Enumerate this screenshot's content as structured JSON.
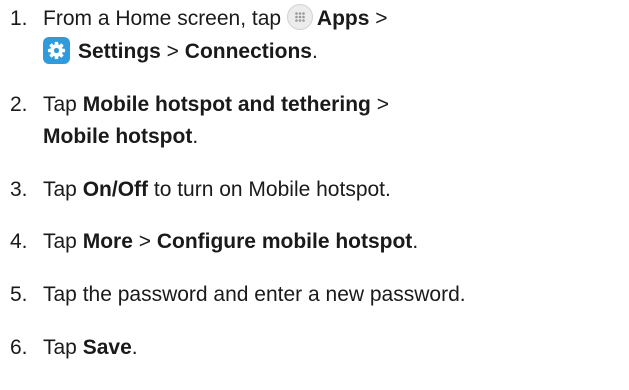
{
  "steps": [
    {
      "number": "1.",
      "lines": [
        [
          "From a Home screen, tap ",
          "Apps",
          " >"
        ],
        [
          "Settings",
          " > ",
          "Connections",
          "."
        ]
      ]
    },
    {
      "number": "2.",
      "lines": [
        [
          "Tap ",
          "Mobile hotspot and tethering",
          " >"
        ],
        [
          "Mobile hotspot",
          "."
        ]
      ]
    },
    {
      "number": "3.",
      "lines": [
        [
          "Tap ",
          "On/Off",
          " to turn on Mobile hotspot."
        ]
      ]
    },
    {
      "number": "4.",
      "lines": [
        [
          "Tap ",
          "More",
          " > ",
          "Configure mobile hotspot",
          "."
        ]
      ]
    },
    {
      "number": "5.",
      "lines": [
        [
          "Tap the password and enter a new password."
        ]
      ]
    },
    {
      "number": "6.",
      "lines": [
        [
          "Tap ",
          "Save",
          "."
        ]
      ]
    }
  ],
  "icons": {
    "apps": "apps-grid-icon",
    "settings": "settings-gear-icon",
    "settings_color": "#2f9bdd"
  }
}
